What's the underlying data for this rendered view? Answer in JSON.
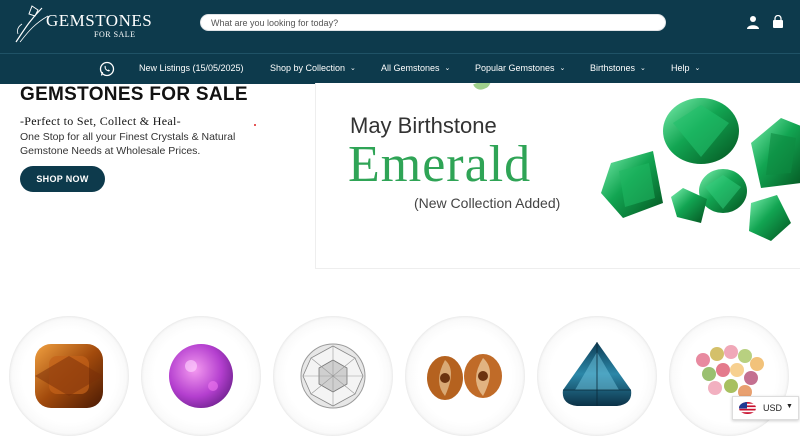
{
  "brand": {
    "name": "GEMSTONES",
    "sub": "FOR SALE"
  },
  "search": {
    "placeholder": "What are you looking for today?"
  },
  "header_icons": [
    "user-icon",
    "cart-icon"
  ],
  "nav": {
    "items": [
      {
        "label": "New Listings (15/05/2025)",
        "has_dropdown": false
      },
      {
        "label": "Shop by Collection",
        "has_dropdown": true
      },
      {
        "label": "All Gemstones",
        "has_dropdown": true
      },
      {
        "label": "Popular Gemstones",
        "has_dropdown": true
      },
      {
        "label": "Birthstones",
        "has_dropdown": true
      },
      {
        "label": "Help",
        "has_dropdown": true
      }
    ],
    "chevron": "⌄"
  },
  "hero": {
    "title": "GEMSTONES FOR SALE",
    "tagline": "-Perfect to Set, Collect & Heal-",
    "description": "One Stop for all your Finest Crystals & Natural Gemstone Needs at Wholesale Prices.",
    "cta": "SHOP NOW"
  },
  "banner": {
    "line1": "May Birthstone",
    "line2": "Emerald",
    "line3": "(New Collection Added)"
  },
  "categories": [
    {
      "icon": "amber-cushion-gem-icon"
    },
    {
      "icon": "purple-opal-cabochon-icon"
    },
    {
      "icon": "white-rose-cut-diamond-icon"
    },
    {
      "icon": "ammonite-fossil-icon"
    },
    {
      "icon": "blue-trillion-topaz-icon"
    },
    {
      "icon": "tourmaline-beads-icon"
    }
  ],
  "currency": {
    "code": "USD",
    "caret": "▼"
  },
  "colors": {
    "primary": "#0d3a4c",
    "emerald": "#2fa456"
  }
}
